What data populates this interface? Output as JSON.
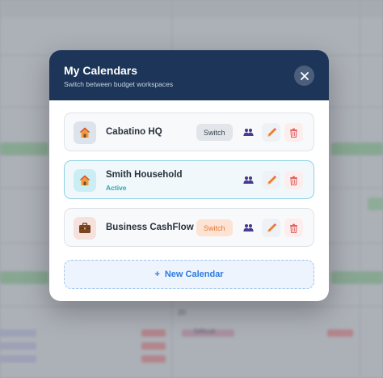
{
  "modal": {
    "title": "My Calendars",
    "subtitle": "Switch between budget workspaces",
    "close_icon": "close-icon"
  },
  "calendars": [
    {
      "name": "Cabatino HQ",
      "icon": "house-icon",
      "status": "",
      "switch_label": "Switch",
      "switch_style": "gray",
      "active": false
    },
    {
      "name": "Smith Household",
      "icon": "house-icon",
      "status": "Active",
      "switch_label": "",
      "active": true
    },
    {
      "name": "Business CashFlow",
      "icon": "briefcase-icon",
      "status": "",
      "switch_label": "Switch",
      "switch_style": "orange",
      "active": false
    }
  ],
  "new_calendar": {
    "plus": "+",
    "label": "New Calendar"
  },
  "background": {
    "row_label": "20",
    "sample_item": "Difficult"
  },
  "colors": {
    "header": "#1c3558",
    "accent_blue": "#2e7be0",
    "active_teal": "#2aa7b7",
    "orange": "#e77834",
    "users_purple": "#4b3b8f",
    "delete_red": "#e26565"
  }
}
